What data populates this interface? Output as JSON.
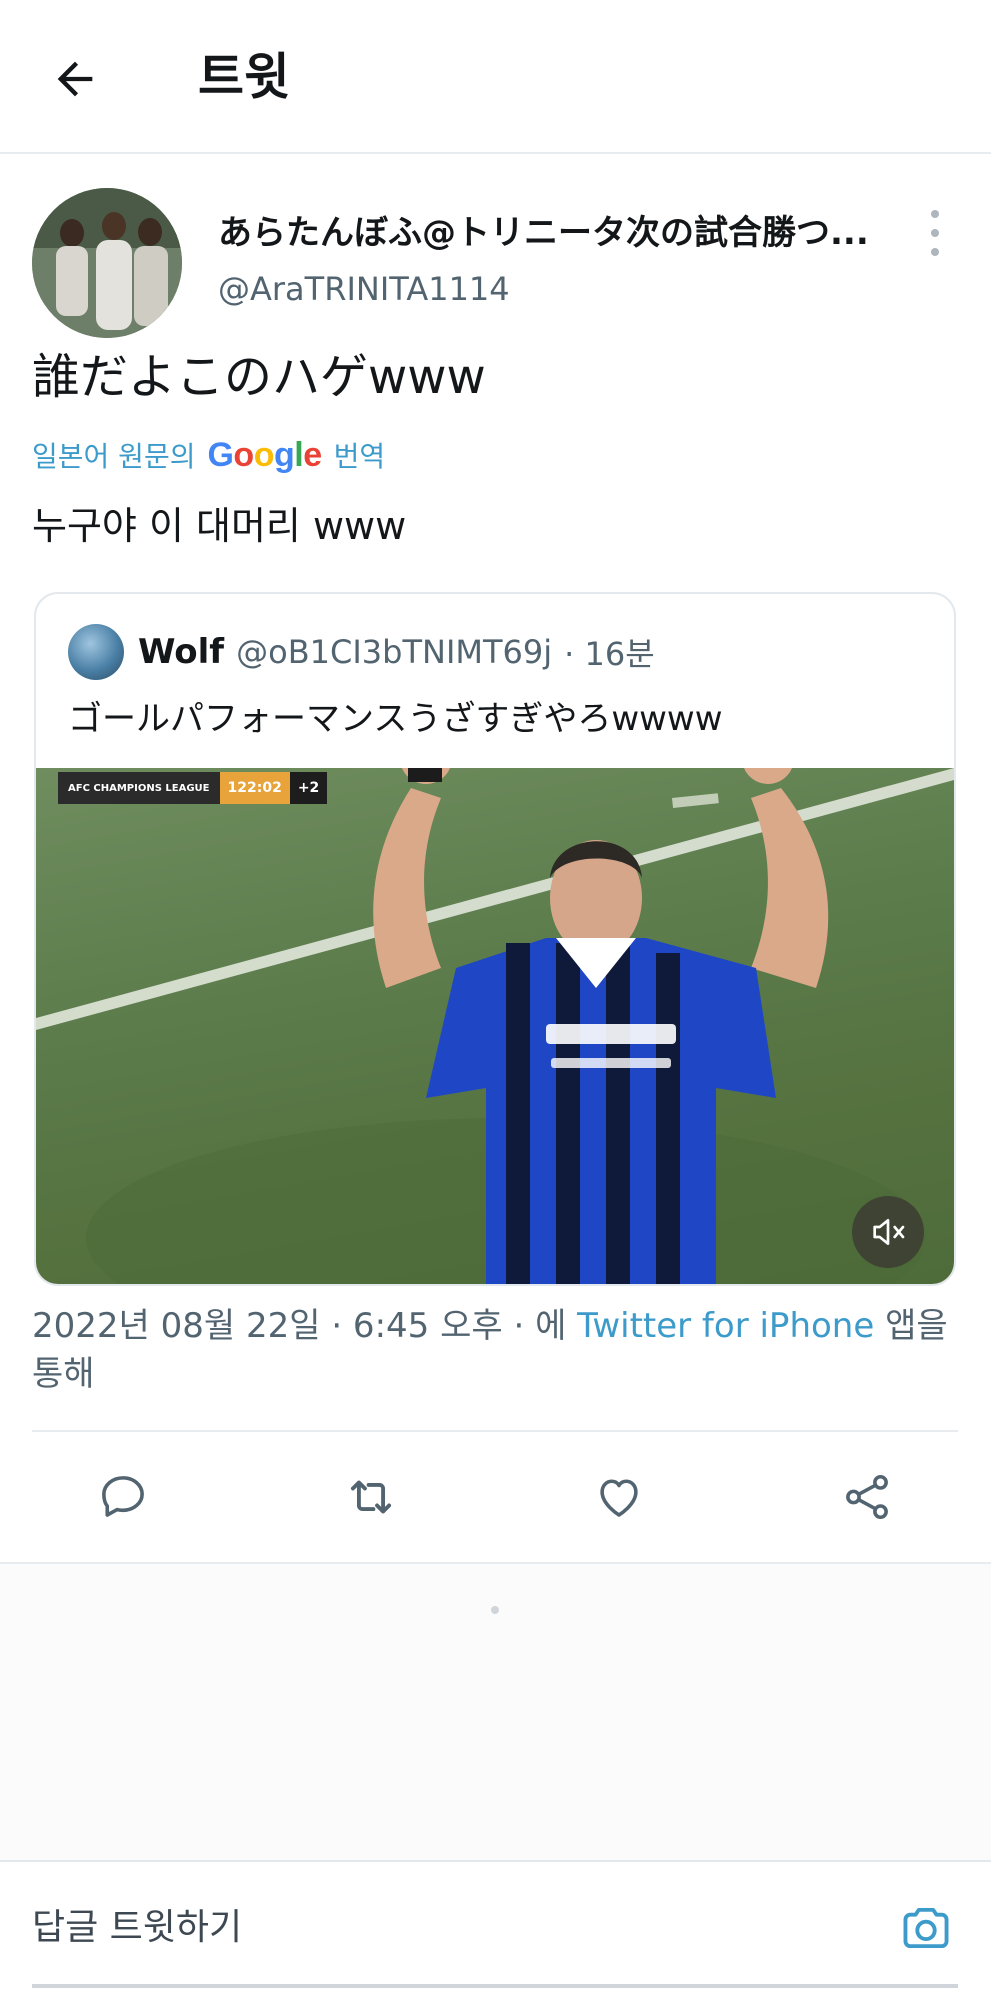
{
  "header": {
    "title": "트윗",
    "back_icon": "arrow-left-icon"
  },
  "tweet": {
    "display_name": "あらたんぼふ@トリニータ次の試合勝つ...",
    "handle": "@AraTRINITA1114",
    "text": "誰だよこのハゲwww",
    "translate": {
      "label_before": "일본어 원문의",
      "provider": "Google",
      "label_after": "번역",
      "translated_text": "누구야 이 대머리 www"
    },
    "quote": {
      "name": "Wolf",
      "handle": "@oB1CI3bTNIMT69j",
      "time": "· 16분",
      "text": "ゴールパフォーマンスうざすぎやろwwww",
      "media": {
        "scoreboard_league": "AFC CHAMPIONS LEAGUE",
        "scoreboard_time": "122:02",
        "scoreboard_extra": "+2",
        "mute_icon": "speaker-muted-icon"
      }
    },
    "timestamp": {
      "date_time": "2022년 08월 22일 · 6:45 오후 · 에 ",
      "client": "Twitter for iPhone",
      "suffix": " 앱을 통해"
    }
  },
  "actions": {
    "reply_icon": "comment-icon",
    "retweet_icon": "retweet-icon",
    "like_icon": "heart-icon",
    "share_icon": "share-icon"
  },
  "reply_bar": {
    "placeholder": "답글 트윗하기",
    "camera_icon": "camera-icon"
  },
  "colors": {
    "accent": "#3c9bcb",
    "secondary_text": "#536471",
    "divider": "#e8ecef"
  }
}
